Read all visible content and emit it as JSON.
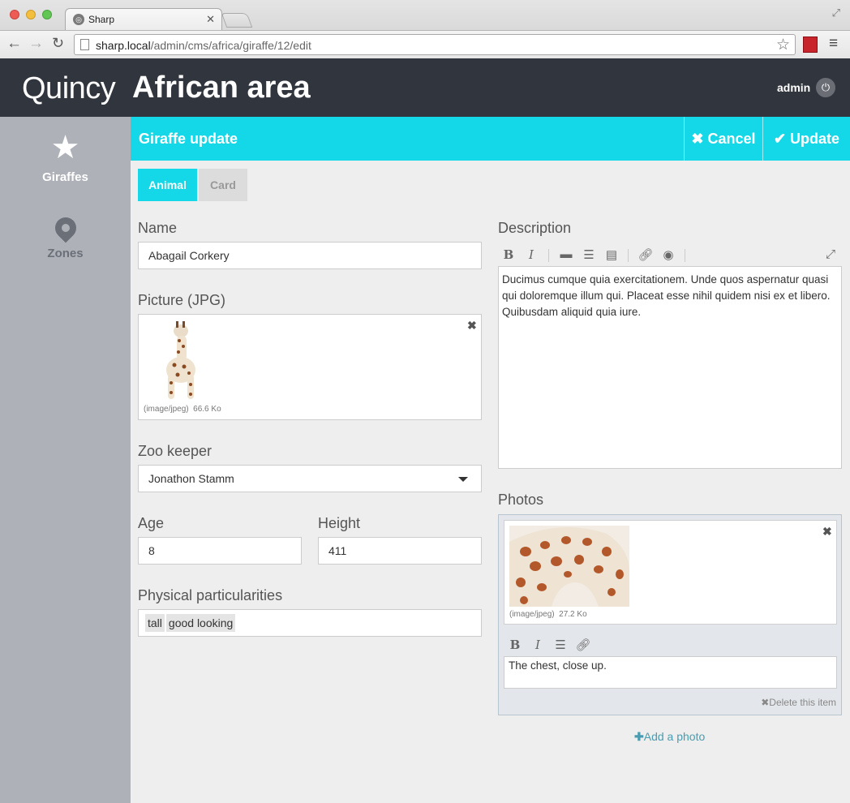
{
  "browser": {
    "tab_title": "Sharp",
    "url_host": "sharp.local",
    "url_path": "/admin/cms/africa/giraffe/12/edit"
  },
  "header": {
    "brand": "Quincy",
    "area_title": "African area",
    "user": "admin"
  },
  "sidebar": {
    "items": [
      {
        "label": "Giraffes",
        "icon": "star-icon",
        "active": true
      },
      {
        "label": "Zones",
        "icon": "map-pin-icon",
        "active": false
      }
    ]
  },
  "titlebar": {
    "title": "Giraffe update",
    "cancel_label": "Cancel",
    "update_label": "Update"
  },
  "tabs": [
    {
      "label": "Animal",
      "active": true
    },
    {
      "label": "Card",
      "active": false
    }
  ],
  "form": {
    "name": {
      "label": "Name",
      "value": "Abagail Corkery"
    },
    "picture": {
      "label": "Picture (JPG)",
      "mime": "(image/jpeg)",
      "size": "66.6 Ko"
    },
    "zookeeper": {
      "label": "Zoo keeper",
      "value": "Jonathon Stamm"
    },
    "age": {
      "label": "Age",
      "value": "8"
    },
    "height": {
      "label": "Height",
      "value": "411"
    },
    "particularities": {
      "label": "Physical particularities",
      "tags": [
        "tall",
        "good looking"
      ]
    },
    "description": {
      "label": "Description",
      "text": "Ducimus cumque quia exercitationem. Unde quos aspernatur quasi qui doloremque illum qui. Placeat esse nihil quidem nisi ex et libero. Quibusdam aliquid quia iure."
    },
    "photos": {
      "label": "Photos",
      "items": [
        {
          "mime": "(image/jpeg)",
          "size": "27.2 Ko",
          "legend": "The chest, close up.",
          "delete_label": "Delete this item"
        }
      ],
      "add_label": "Add a photo"
    }
  },
  "colors": {
    "accent": "#14d8e8",
    "header_bg": "#31353e",
    "sidebar_bg": "#aeb2b8"
  }
}
